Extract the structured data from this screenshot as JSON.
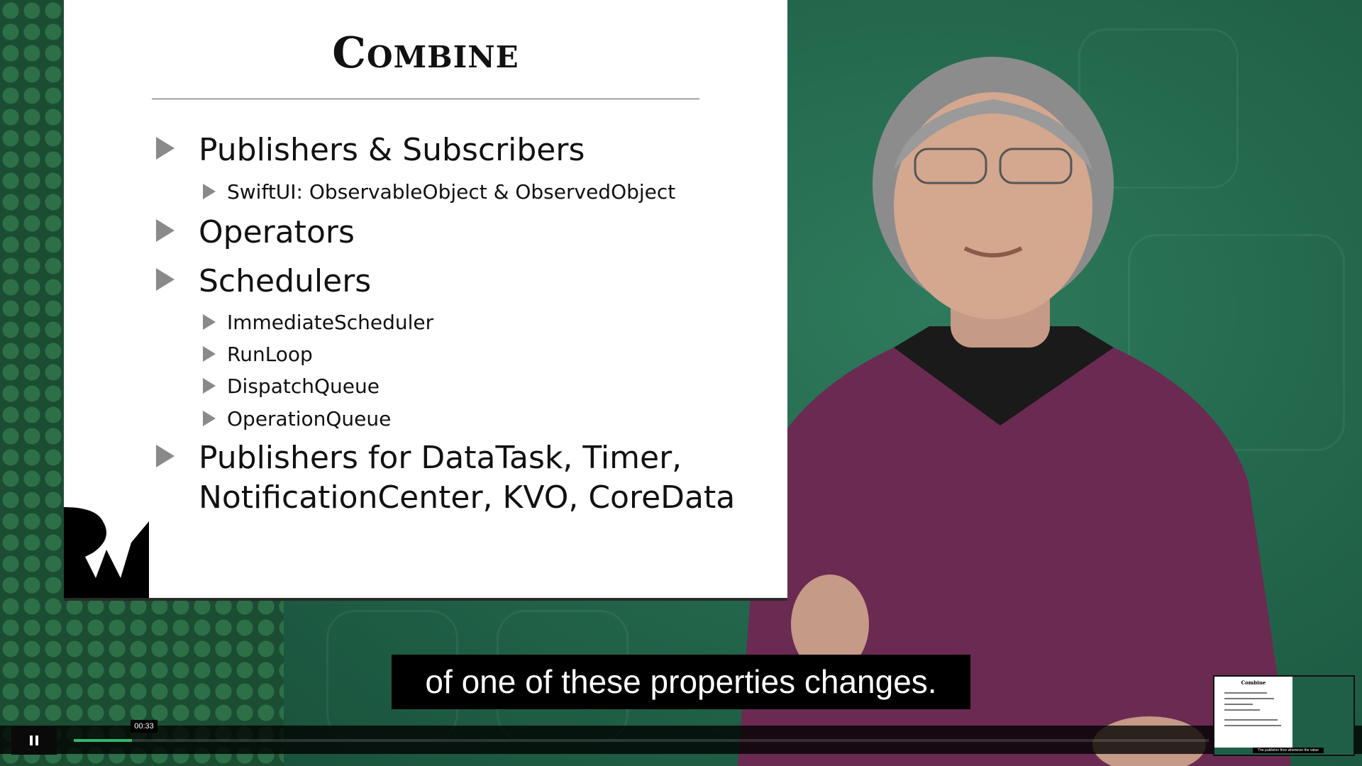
{
  "slide": {
    "title": "Combine",
    "items": [
      {
        "text": "Publishers & Subscribers",
        "level": 1
      },
      {
        "text": "SwiftUI: ObservableObject & ObservedObject",
        "level": 2
      },
      {
        "text": "Operators",
        "level": 1
      },
      {
        "text": "Schedulers",
        "level": 1
      },
      {
        "text": "ImmediateScheduler",
        "level": 2
      },
      {
        "text": "RunLoop",
        "level": 2
      },
      {
        "text": "DispatchQueue",
        "level": 2
      },
      {
        "text": "OperationQueue",
        "level": 2
      },
      {
        "text": "Publishers for DataTask, Timer,",
        "level": 1
      },
      {
        "text": "NotificationCenter, KVO, CoreData",
        "level": 1
      }
    ]
  },
  "subtitle": {
    "text": "of one of these properties changes."
  },
  "player": {
    "current_time": "00:33",
    "progress": 0.051,
    "accent_color": "#2fb56f",
    "play_state_icon": "pause-icon"
  },
  "thumbnail": {
    "title": "Combine",
    "caption": "The publisher fires whenever the value"
  }
}
